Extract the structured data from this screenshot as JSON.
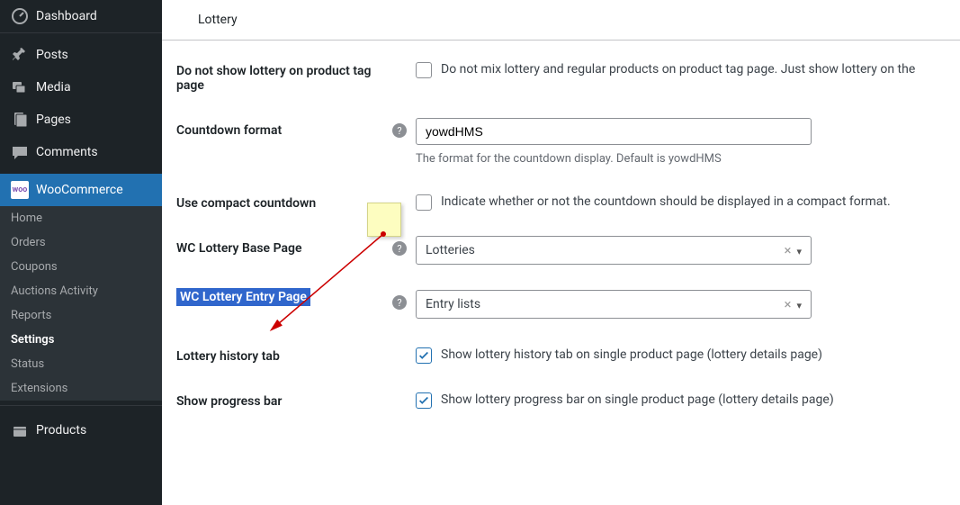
{
  "sidebar": {
    "dashboard": "Dashboard",
    "posts": "Posts",
    "media": "Media",
    "pages": "Pages",
    "comments": "Comments",
    "woocommerce": "WooCommerce",
    "products": "Products",
    "submenu": {
      "home": "Home",
      "orders": "Orders",
      "coupons": "Coupons",
      "auctions": "Auctions Activity",
      "reports": "Reports",
      "settings": "Settings",
      "status": "Status",
      "extensions": "Extensions"
    }
  },
  "tab": "Lottery",
  "rows": {
    "noshow_tag": {
      "label": "Do not show lottery on product tag page",
      "desc": "Do not mix lottery and regular products on product tag page. Just show lottery on the"
    },
    "countdown_format": {
      "label": "Countdown format",
      "value": "yowdHMS",
      "sub": "The format for the countdown display. Default is yowdHMS"
    },
    "compact": {
      "label": "Use compact countdown",
      "desc": "Indicate whether or not the countdown should be displayed in a compact format."
    },
    "base_page": {
      "label": "WC Lottery Base Page",
      "value": "Lotteries"
    },
    "entry_page": {
      "label": "WC Lottery Entry Page",
      "value": "Entry lists"
    },
    "history": {
      "label": "Lottery history tab",
      "desc": "Show lottery history tab on single product page (lottery details page)"
    },
    "progress": {
      "label": "Show progress bar",
      "desc": "Show lottery progress bar on single product page (lottery details page)"
    }
  }
}
